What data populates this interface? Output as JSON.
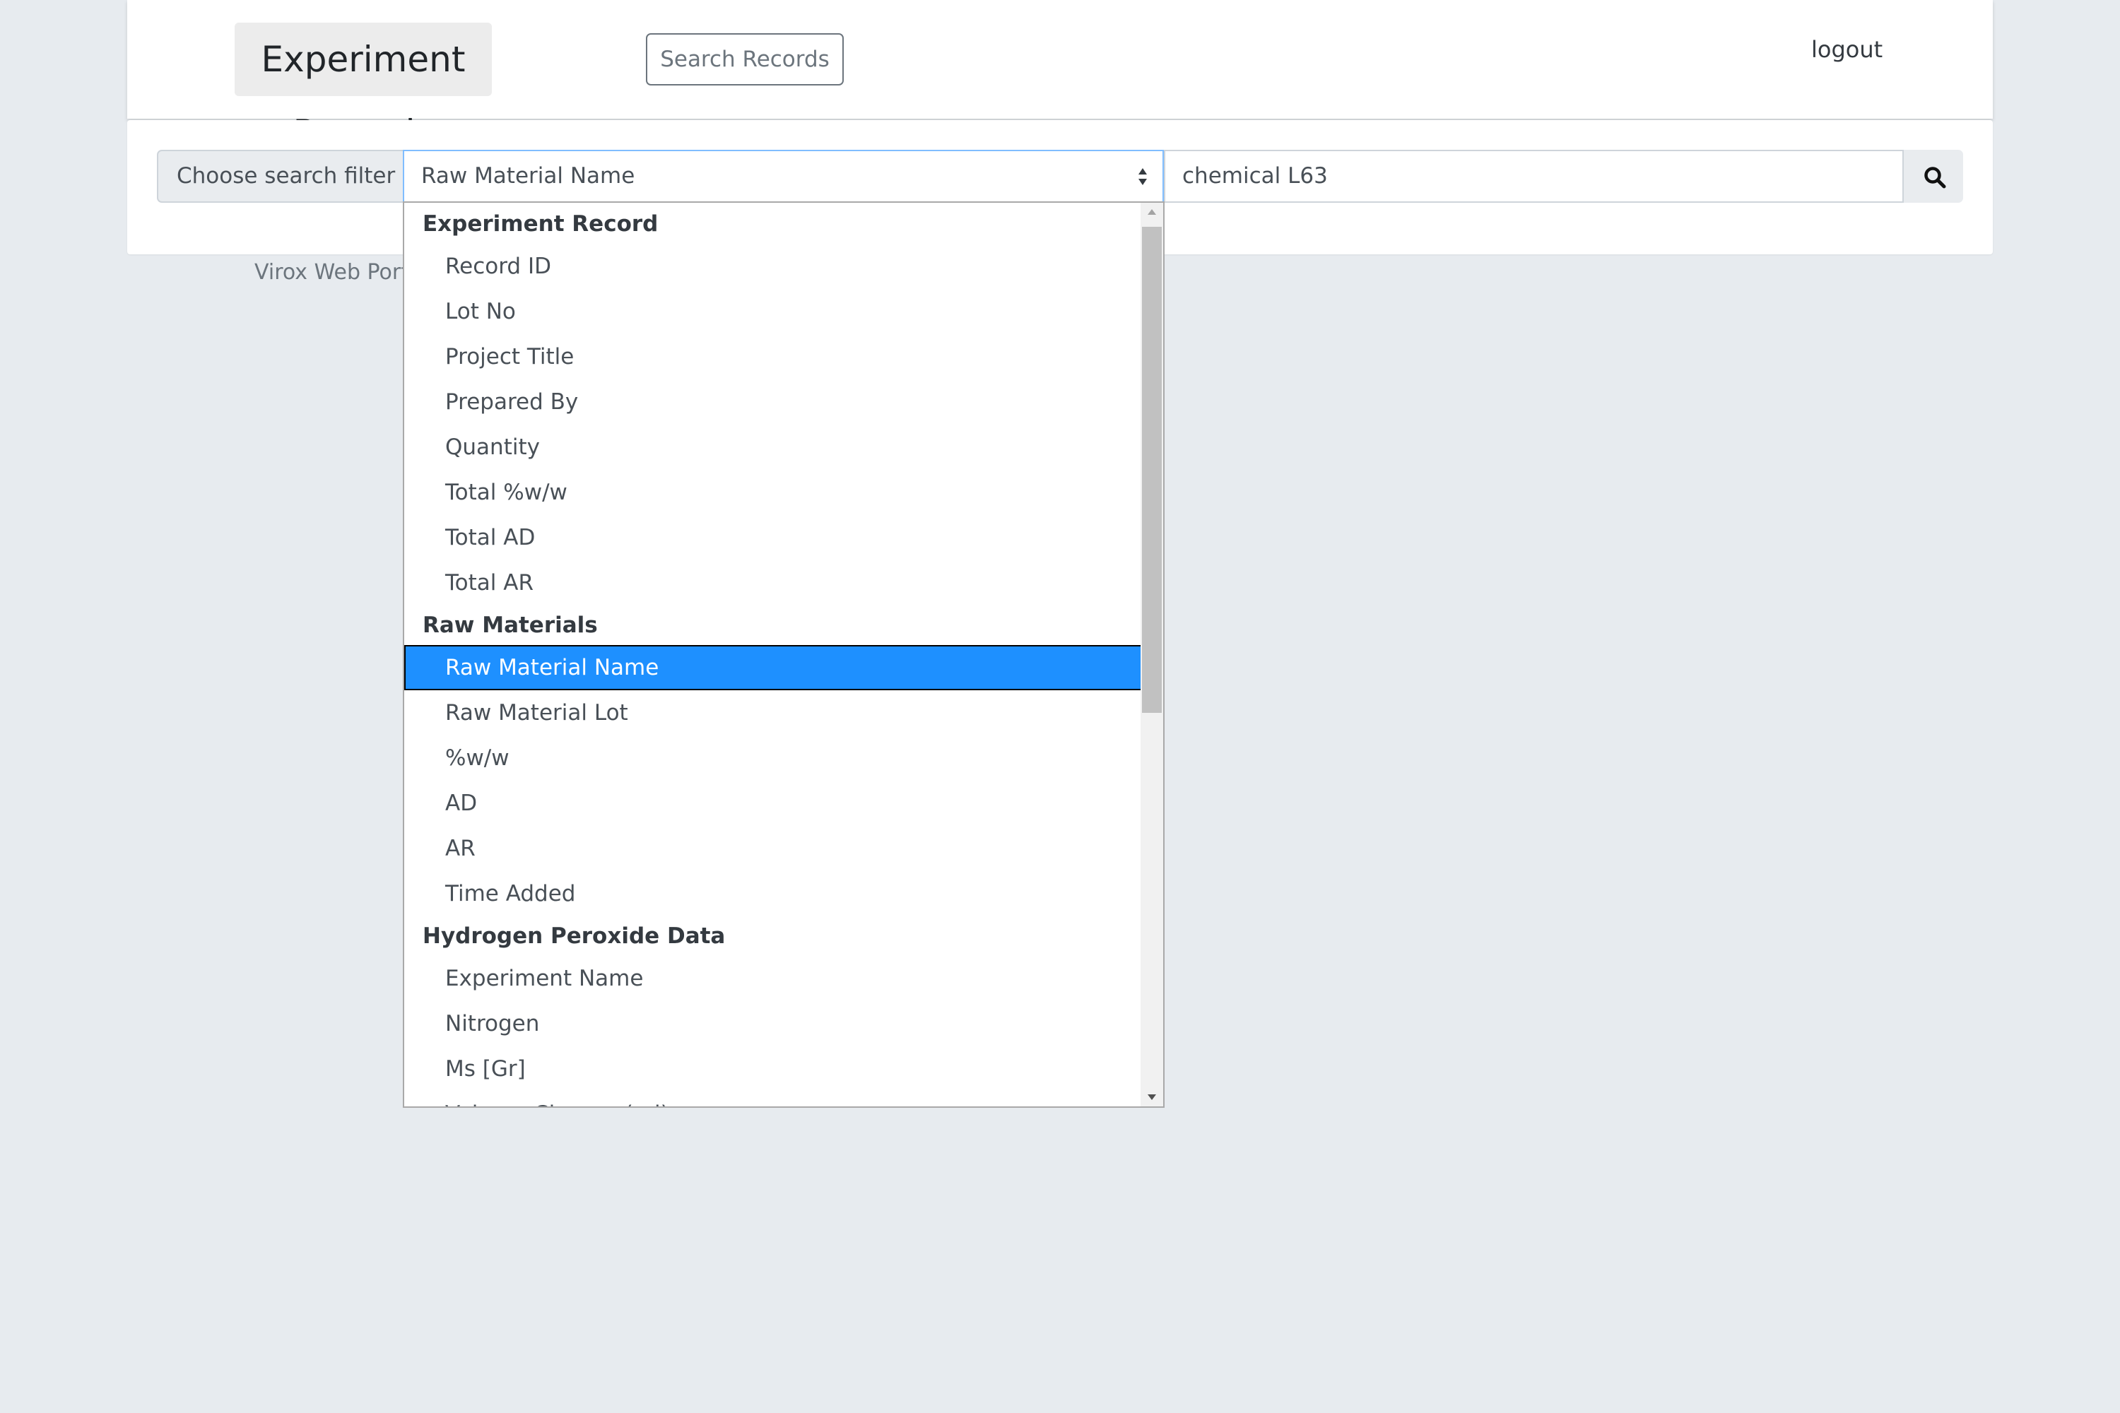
{
  "header": {
    "brand": "Experiment Records",
    "search_records_label": "Search Records",
    "logout_label": "logout"
  },
  "search": {
    "filter_label": "Choose search filter",
    "selected_filter": "Raw Material Name",
    "query_value": "chemical L63",
    "search_icon": "search-icon"
  },
  "footer": {
    "text": "Virox Web Portal"
  },
  "dropdown": {
    "groups": [
      {
        "label": "Experiment Record",
        "options": [
          "Record ID",
          "Lot No",
          "Project Title",
          "Prepared By",
          "Quantity",
          "Total %w/w",
          "Total AD",
          "Total AR"
        ]
      },
      {
        "label": "Raw Materials",
        "options": [
          "Raw Material Name",
          "Raw Material Lot",
          "%w/w",
          "AD",
          "AR",
          "Time Added"
        ]
      },
      {
        "label": "Hydrogen Peroxide Data",
        "options": [
          "Experiment Name",
          "Nitrogen",
          "Ms [Gr]",
          "Volume Change (ml)"
        ]
      }
    ],
    "selected_color": "#1e90ff"
  }
}
